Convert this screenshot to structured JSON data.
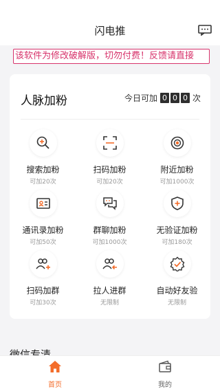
{
  "header": {
    "title": "闪电推",
    "message_icon": "chat-icon"
  },
  "notice": "该软件为修改破解版，切勿付费！反馈请直接",
  "card": {
    "title": "人脉加粉",
    "counter": {
      "prefix": "今日可加",
      "digits": [
        "0",
        "0",
        "0"
      ],
      "suffix": "次"
    }
  },
  "features": [
    {
      "name": "搜索加粉",
      "limit": "可加20次",
      "icon": "search-plus-icon"
    },
    {
      "name": "扫码加粉",
      "limit": "可加20次",
      "icon": "scan-icon"
    },
    {
      "name": "附近加粉",
      "limit": "可加1000次",
      "icon": "location-icon"
    },
    {
      "name": "通讯录加粉",
      "limit": "可加50次",
      "icon": "contact-card-icon"
    },
    {
      "name": "群聊加粉",
      "limit": "可加1000次",
      "icon": "group-chat-icon"
    },
    {
      "name": "无验证加粉",
      "limit": "可加180次",
      "icon": "shield-plus-icon"
    },
    {
      "name": "扫码加群",
      "limit": "可加30次",
      "icon": "users-add-icon"
    },
    {
      "name": "拉人进群",
      "limit": "无限制",
      "icon": "users-pull-icon"
    },
    {
      "name": "自动好友验",
      "limit": "无限制",
      "icon": "badge-check-icon"
    }
  ],
  "section": {
    "title": "微信专清"
  },
  "tabbar": {
    "items": [
      {
        "label": "首页",
        "icon": "home-icon",
        "active": true
      },
      {
        "label": "我的",
        "icon": "wallet-icon",
        "active": false
      }
    ]
  },
  "colors": {
    "accent": "#f36d2b",
    "notice": "#d7336b",
    "icon_dark": "#333333"
  }
}
